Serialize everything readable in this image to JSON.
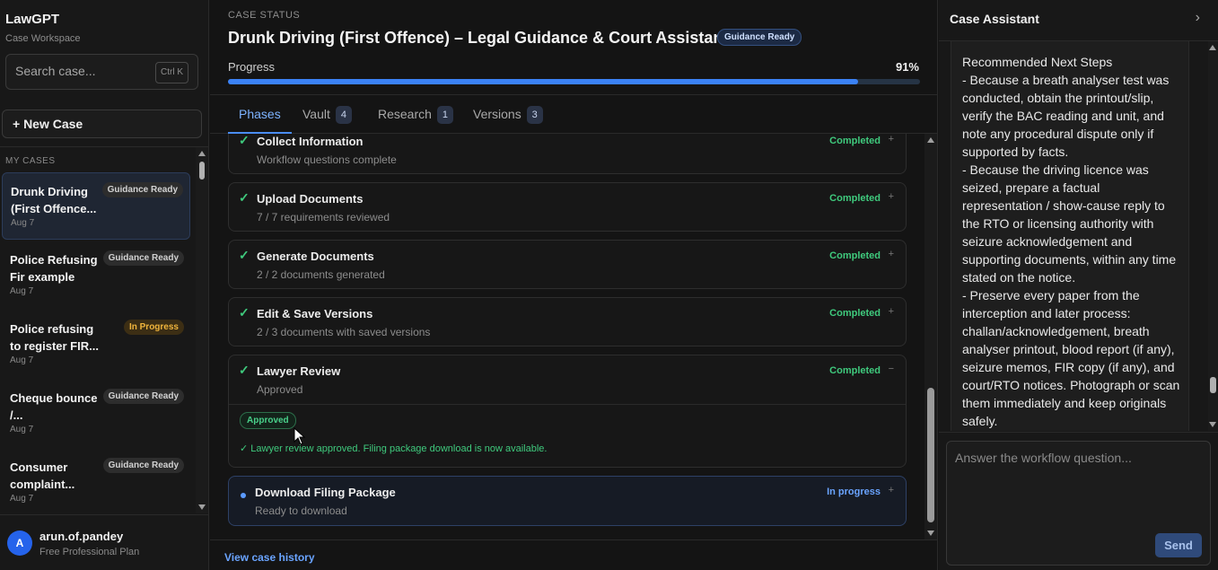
{
  "sidebar": {
    "brand": "LawGPT",
    "brand_sub": "Case Workspace",
    "search_placeholder": "Search case...",
    "search_shortcut": "Ctrl K",
    "new_case_label": "+ New Case",
    "section_label": "MY CASES",
    "cases": [
      {
        "title": "Drunk Driving (First Offence...",
        "badge": "Guidance Ready",
        "date": "Aug 7"
      },
      {
        "title": "Police Refusing Fir example",
        "badge": "Guidance Ready",
        "date": "Aug 7"
      },
      {
        "title": "Police refusing to register FIR...",
        "badge": "In Progress",
        "date": "Aug 7"
      },
      {
        "title": "Cheque bounce /...",
        "badge": "Guidance Ready",
        "date": "Aug 7"
      },
      {
        "title": "Consumer complaint...",
        "badge": "Guidance Ready",
        "date": "Aug 7"
      }
    ],
    "user": {
      "initial": "A",
      "name": "arun.of.pandey",
      "plan": "Free Professional Plan"
    }
  },
  "main": {
    "status_label": "CASE STATUS",
    "title": "Drunk Driving (First Offence) – Legal Guidance & Court Assistance",
    "title_badge": "Guidance Ready",
    "progress_label": "Progress",
    "progress_pct": "91%",
    "progress_value": 0.91,
    "tabs": [
      {
        "label": "Phases",
        "count": ""
      },
      {
        "label": "Vault",
        "count": "4"
      },
      {
        "label": "Research",
        "count": "1"
      },
      {
        "label": "Versions",
        "count": "3"
      }
    ],
    "phases": [
      {
        "title": "Collect Information",
        "sub": "Workflow questions complete",
        "status": "Completed",
        "toggle": "+"
      },
      {
        "title": "Upload Documents",
        "sub": "7 / 7 requirements reviewed",
        "status": "Completed",
        "toggle": "+"
      },
      {
        "title": "Generate Documents",
        "sub": "2 / 2 documents generated",
        "status": "Completed",
        "toggle": "+"
      },
      {
        "title": "Edit & Save Versions",
        "sub": "2 / 3 documents with saved versions",
        "status": "Completed",
        "toggle": "+"
      },
      {
        "title": "Lawyer Review",
        "sub": "Approved",
        "status": "Completed",
        "toggle": "−",
        "pill": "Approved",
        "message": "✓ Lawyer review approved. Filing package download is now available."
      },
      {
        "title": "Download Filing Package",
        "sub": "Ready to download",
        "status": "In progress",
        "toggle": "+"
      }
    ],
    "history_link": "View case history"
  },
  "assistant": {
    "title": "Case Assistant",
    "message": "Recommended Next Steps\n- Because a breath analyser test was conducted, obtain the printout/slip, verify the BAC reading and unit, and note any procedural dispute only if supported by facts.\n- Because the driving licence was seized, prepare a factual representation / show-cause reply to the RTO or licensing authority with seizure acknowledgement and supporting documents, within any time stated on the notice.\n- Preserve every paper from the interception and later process: challan/acknowledgement, breath analyser printout, blood report (if any), seizure memos, FIR copy (if any), and court/RTO notices. Photograph or scan them immediately and keep originals safely.",
    "input_placeholder": "Answer the workflow question...",
    "send_label": "Send"
  },
  "colors": {
    "accent": "#3b82f6",
    "success": "#3fca7d",
    "warning": "#f0b43c"
  }
}
